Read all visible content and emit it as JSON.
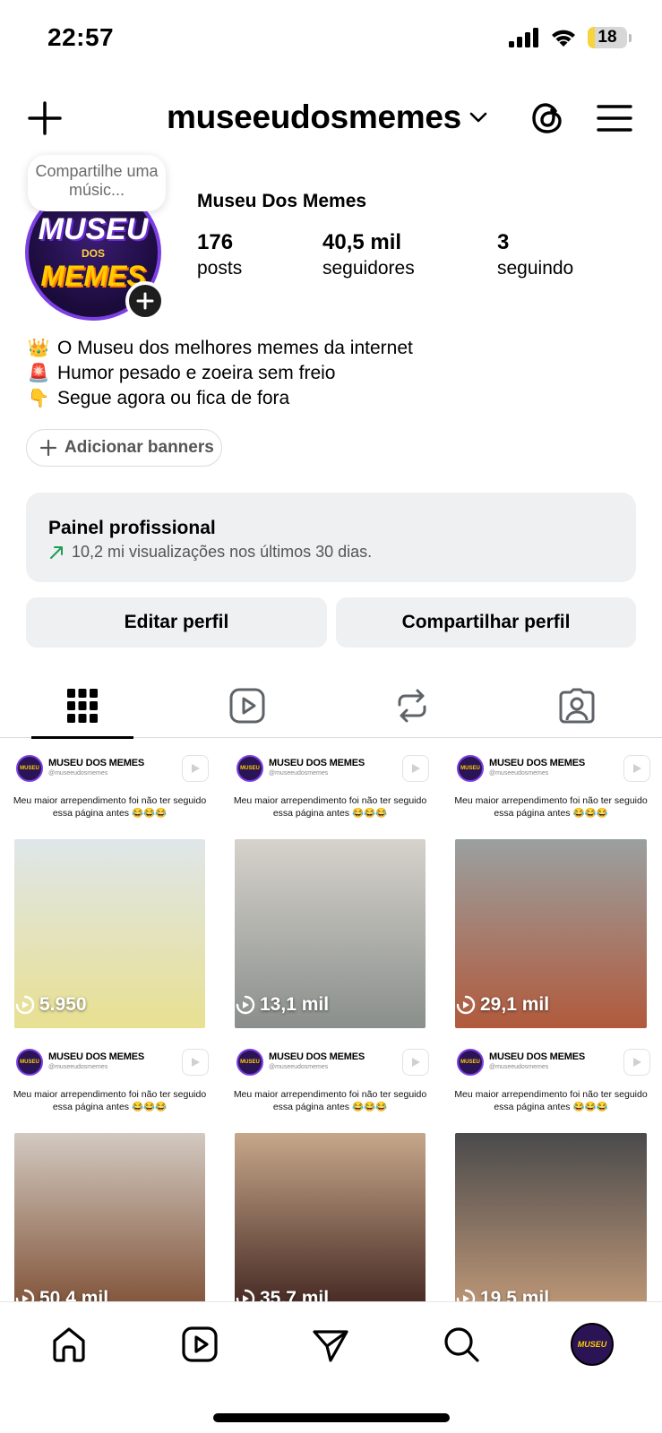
{
  "status_bar": {
    "time": "22:57",
    "battery": "18"
  },
  "header": {
    "username": "museeudosmemes"
  },
  "note": {
    "text": "Compartilhe uma músic..."
  },
  "avatar": {
    "line1": "MUSEU",
    "line2": "DOS",
    "line3": "MEMES"
  },
  "profile": {
    "name": "Museu Dos Memes",
    "stats": [
      {
        "value": "176",
        "label": "posts"
      },
      {
        "value": "40,5 mil",
        "label": "seguidores"
      },
      {
        "value": "3",
        "label": "seguindo"
      }
    ],
    "bio": [
      {
        "emoji": "👑",
        "text": "O Museu dos melhores memes da internet"
      },
      {
        "emoji": "🚨",
        "text": "Humor pesado e zoeira sem freio"
      },
      {
        "emoji": "👇",
        "text": "Segue agora ou fica de fora"
      }
    ],
    "banners_label": "Adicionar banners"
  },
  "dashboard": {
    "title": "Painel profissional",
    "subtitle": "10,2 mi visualizações nos últimos 30 dias."
  },
  "actions": {
    "edit": "Editar perfil",
    "share": "Compartilhar perfil"
  },
  "tabs": [
    {
      "name": "grid",
      "active": true
    },
    {
      "name": "reels",
      "active": false
    },
    {
      "name": "reposts",
      "active": false
    },
    {
      "name": "tagged",
      "active": false
    }
  ],
  "posts_common": {
    "account": "MUSEU DOS MEMES",
    "handle": "@museeudosmemes",
    "caption": "Meu maior arrependimento foi não ter seguido essa página antes 😂😂😂"
  },
  "posts": [
    {
      "views": "5.950",
      "colors": [
        "#dfe6ea",
        "#e8e091"
      ]
    },
    {
      "views": "13,1 mil",
      "colors": [
        "#d6d2cc",
        "#8a8f8c"
      ]
    },
    {
      "views": "29,1 mil",
      "colors": [
        "#9aa0a0",
        "#b15a3c"
      ]
    },
    {
      "views": "50,4 mil",
      "colors": [
        "#d3c9c0",
        "#7a4a2e"
      ]
    },
    {
      "views": "35,7 mil",
      "colors": [
        "#c7a78a",
        "#3a1e1a"
      ]
    },
    {
      "views": "19,5 mil",
      "colors": [
        "#4a4a4c",
        "#c79d7a"
      ]
    }
  ],
  "nav": [
    "home",
    "reels",
    "messages",
    "search",
    "profile"
  ]
}
